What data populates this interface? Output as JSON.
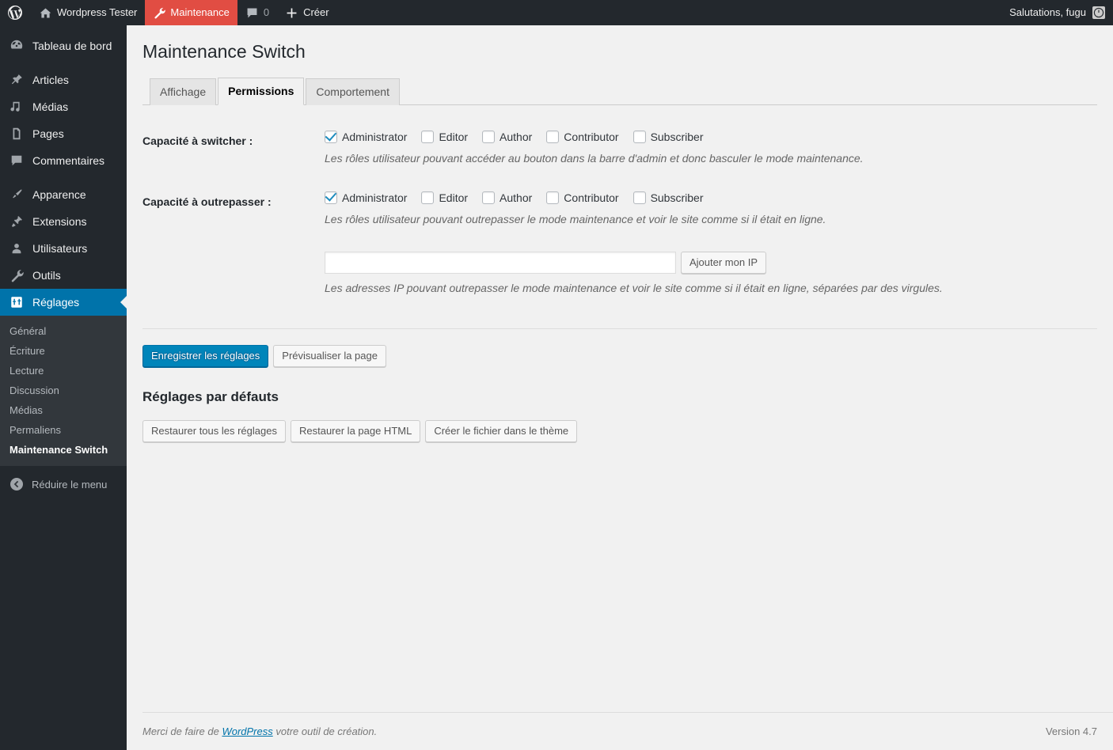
{
  "adminbar": {
    "wp_logo": "wordpress-logo-icon",
    "site_name": "Wordpress Tester",
    "maintenance": "Maintenance",
    "comments_count": "0",
    "new_label": "Créer",
    "greeting": "Salutations, fugu"
  },
  "sidebar": {
    "items": [
      {
        "label": "Tableau de bord",
        "icon": "dashboard-icon",
        "current": false
      },
      {
        "label": "Articles",
        "icon": "pin-icon",
        "current": false
      },
      {
        "label": "Médias",
        "icon": "media-icon",
        "current": false
      },
      {
        "label": "Pages",
        "icon": "page-icon",
        "current": false
      },
      {
        "label": "Commentaires",
        "icon": "comment-icon",
        "current": false
      },
      {
        "label": "Apparence",
        "icon": "brush-icon",
        "current": false
      },
      {
        "label": "Extensions",
        "icon": "plugin-icon",
        "current": false
      },
      {
        "label": "Utilisateurs",
        "icon": "user-icon",
        "current": false
      },
      {
        "label": "Outils",
        "icon": "wrench-icon",
        "current": false
      },
      {
        "label": "Réglages",
        "icon": "settings-icon",
        "current": true
      }
    ],
    "submenu": [
      {
        "label": "Général",
        "current": false
      },
      {
        "label": "Écriture",
        "current": false
      },
      {
        "label": "Lecture",
        "current": false
      },
      {
        "label": "Discussion",
        "current": false
      },
      {
        "label": "Médias",
        "current": false
      },
      {
        "label": "Permaliens",
        "current": false
      },
      {
        "label": "Maintenance Switch",
        "current": true
      }
    ],
    "collapse_label": "Réduire le menu"
  },
  "page": {
    "title": "Maintenance Switch",
    "tabs": [
      {
        "label": "Affichage",
        "active": false
      },
      {
        "label": "Permissions",
        "active": true
      },
      {
        "label": "Comportement",
        "active": false
      }
    ]
  },
  "form": {
    "row1": {
      "label": "Capacité à switcher :",
      "roles": [
        {
          "label": "Administrator",
          "checked": true
        },
        {
          "label": "Editor",
          "checked": false
        },
        {
          "label": "Author",
          "checked": false
        },
        {
          "label": "Contributor",
          "checked": false
        },
        {
          "label": "Subscriber",
          "checked": false
        }
      ],
      "description": "Les rôles utilisateur pouvant accéder au bouton dans la barre d'admin et donc basculer le mode maintenance."
    },
    "row2": {
      "label": "Capacité à outrepasser :",
      "roles": [
        {
          "label": "Administrator",
          "checked": true
        },
        {
          "label": "Editor",
          "checked": false
        },
        {
          "label": "Author",
          "checked": false
        },
        {
          "label": "Contributor",
          "checked": false
        },
        {
          "label": "Subscriber",
          "checked": false
        }
      ],
      "description": "Les rôles utilisateur pouvant outrepasser le mode maintenance et voir le site comme si il était en ligne."
    },
    "ip": {
      "value": "",
      "placeholder": "",
      "button": "Ajouter mon IP",
      "description": "Les adresses IP pouvant outrepasser le mode maintenance et voir le site comme si il était en ligne, séparées par des virgules."
    }
  },
  "actions": {
    "save": "Enregistrer les réglages",
    "preview": "Prévisualiser la page",
    "defaults_heading": "Réglages par défauts",
    "restore_all": "Restaurer tous les réglages",
    "restore_html": "Restaurer la page HTML",
    "create_file": "Créer le fichier dans le thème"
  },
  "footer": {
    "thanks_prefix": "Merci de faire de ",
    "link": "WordPress",
    "thanks_suffix": " votre outil de création.",
    "version": "Version 4.7"
  },
  "colors": {
    "admin_dark": "#23282d",
    "submenu_dark": "#32373c",
    "accent_blue": "#0073aa",
    "primary_button": "#0085ba",
    "highlight_orange": "#e14d43",
    "page_bg": "#f1f1f1"
  }
}
